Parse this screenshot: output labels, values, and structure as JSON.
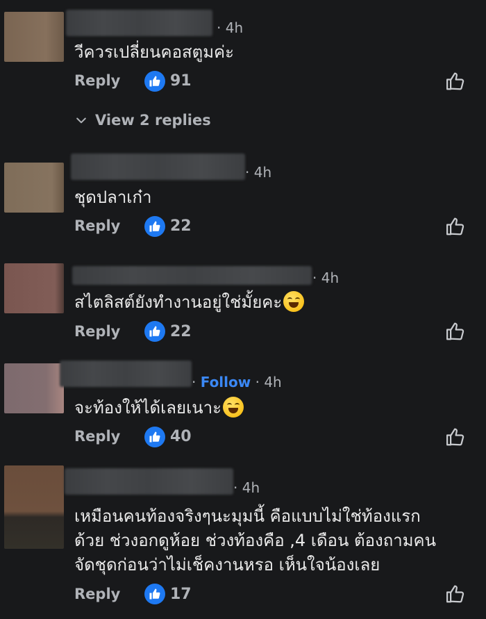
{
  "comments": [
    {
      "time": "· 4h",
      "text_lines": [
        "วีควรเปลี่ยนคอสตูมค่ะ"
      ],
      "reply_label": "Reply",
      "likes": "91",
      "avatar_color": "#7b6653",
      "view_replies": "View 2 replies"
    },
    {
      "time": "· 4h",
      "text_lines": [
        "ชุดปลาเก๋า"
      ],
      "reply_label": "Reply",
      "likes": "22",
      "avatar_color": "#7d6b58"
    },
    {
      "time": "· 4h",
      "text_lines": [
        "สไตลิสต์ยังทำงานอยู่ใช่มั้ยคะ"
      ],
      "emoji": "laughing-tears-emoji",
      "reply_label": "Reply",
      "likes": "22",
      "avatar_color": "#7a5650"
    },
    {
      "time": "· 4h",
      "follow": "Follow",
      "text_lines": [
        "จะท้องให้ได้เลยเนาะ"
      ],
      "emoji": "grinning-sweat-emoji",
      "reply_label": "Reply",
      "likes": "40",
      "avatar_color": "#7d6a6e"
    },
    {
      "time": "· 4h",
      "text_lines": [
        "เหมือนคนท้องจริงๆนะมุมนี้ คือแบบไม่ใช่ท้องแรก",
        "ด้วย ช่วงอกดูห้อย ช่วงท้องคือ ,4 เดือน   ต้องถามคน",
        "จัดชุดก่อนว่าไม่เช็คงานหรอ เห็นใจน้องเลย"
      ],
      "reply_label": "Reply",
      "likes": "17",
      "avatar_color": "#6a4d3b"
    }
  ]
}
